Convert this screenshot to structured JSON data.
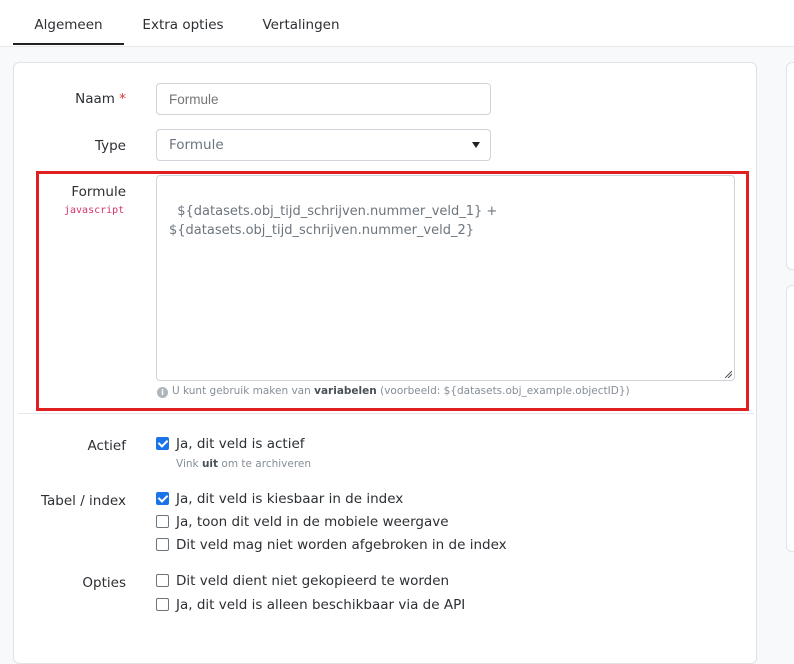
{
  "tabs": [
    "Algemeen",
    "Extra opties",
    "Vertalingen"
  ],
  "form": {
    "naam_label": "Naam",
    "required_mark": "*",
    "naam_value": "Formule",
    "type_label": "Type",
    "type_value": "Formule",
    "formule_label": "Formule",
    "formule_lang": "javascript",
    "formule_value": "${datasets.obj_tijd_schrijven.nummer_veld_1} +\n${datasets.obj_tijd_schrijven.nummer_veld_2}",
    "help_prefix": "U kunt gebruik maken van",
    "help_bold": "variabelen",
    "help_suffix": "(voorbeeld: ${datasets.obj_example.objectID})",
    "info_icon": "i"
  },
  "actief": {
    "label": "Actief",
    "checkbox_label": "Ja, dit veld is actief",
    "checked": true,
    "help_prefix": "Vink",
    "help_bold": "uit",
    "help_suffix": "om te archiveren"
  },
  "tabel_index": {
    "label": "Tabel / index",
    "options": [
      {
        "label": "Ja, dit veld is kiesbaar in de index",
        "checked": true
      },
      {
        "label": "Ja, toon dit veld in de mobiele weergave",
        "checked": false
      },
      {
        "label": "Dit veld mag niet worden afgebroken in de index",
        "checked": false
      }
    ]
  },
  "opties": {
    "label": "Opties",
    "options": [
      {
        "label": "Dit veld dient niet gekopieerd te worden",
        "checked": false
      },
      {
        "label": "Ja, dit veld is alleen beschikbaar via de API",
        "checked": false
      }
    ]
  },
  "colors": {
    "accent": "#1a73e8",
    "required": "#e03131",
    "highlight": "#e02020",
    "code_tag": "#d6336c"
  }
}
